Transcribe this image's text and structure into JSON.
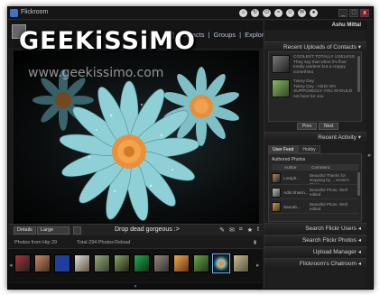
{
  "app": {
    "title": "Flickroom"
  },
  "watermark": {
    "brand": "GEEKiSSiMO",
    "url": "www.geekissimo.com"
  },
  "window_buttons": [
    "_",
    "□",
    "x"
  ],
  "nav": {
    "links": [
      "Contacts",
      "Groups",
      "Explored"
    ],
    "separator": "|"
  },
  "toolbar": {
    "details_label": "Details",
    "size_value": "Large",
    "photo_title": "Drop dead gorgeous :>"
  },
  "photos_bar": {
    "source": "Photos from Hip 29",
    "total": "Total 294 Photos",
    "reload": "Reload"
  },
  "sidebar": {
    "user": "Ashu Mittal",
    "recent_uploads_title": "Recent Uploads of Contacts ▾",
    "uploads": [
      {
        "title": "COOLEST TOTALLY USELESS",
        "text": "They say that when it's flow totally useless but a crappy something"
      },
      {
        "title": "Tukey Day",
        "text": "Tukey Day - HEIS ON SUPPOSEDLY YOU SHOULD not here for you"
      }
    ],
    "prev_label": "Prev",
    "next_label": "Next",
    "recent_activity_title": "Recent Activity ▾",
    "tabs": [
      "User Feed",
      "Hobby"
    ],
    "activity": {
      "heading": "Authored Photos",
      "col_author": "Author",
      "col_comment": "Comment",
      "rows": [
        {
          "author": "Loreph...",
          "comment": "Beautiful Thanks for stopping by ... Kevin's Place..."
        },
        {
          "author": "Aditi Sharm...",
          "comment": "Beautiful Photo. Well edited"
        },
        {
          "author": "Saurab...",
          "comment": "Beautiful Photo. Well edited"
        }
      ]
    },
    "search_flickr_users": "Search Flickr Users ◂",
    "search_flickr_photos": "Search Flickr Photos ◂",
    "upload_manager": "Upload Manager ◂",
    "flickroom_chatroom": "Flickroom's Chatroom ◂"
  },
  "colors": {
    "window_bg": "#1b1b1b",
    "accent": "#7ab3ff",
    "petal": "#7fc0c7",
    "flower_center": "#e58f3c"
  }
}
